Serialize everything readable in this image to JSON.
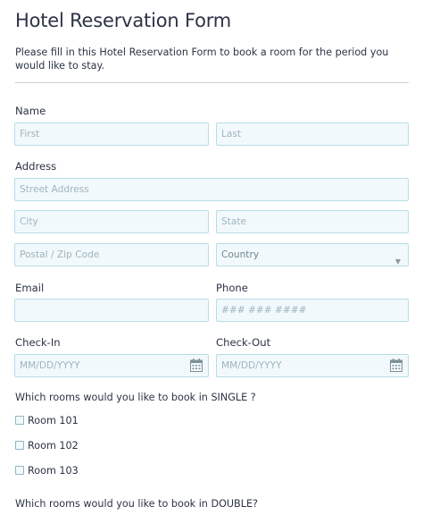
{
  "form": {
    "title": "Hotel Reservation Form",
    "description": "Please fill in this Hotel Reservation Form to book a room for the period you would like to stay."
  },
  "name": {
    "label": "Name",
    "first_placeholder": "First",
    "last_placeholder": "Last"
  },
  "address": {
    "label": "Address",
    "street_placeholder": "Street Address",
    "city_placeholder": "City",
    "state_placeholder": "State",
    "zip_placeholder": "Postal / Zip Code",
    "country_value": "Country"
  },
  "email": {
    "label": "Email",
    "placeholder": ""
  },
  "phone": {
    "label": "Phone",
    "placeholder": "### ### ####"
  },
  "checkin": {
    "label": "Check-In",
    "placeholder": "MM/DD/YYYY"
  },
  "checkout": {
    "label": "Check-Out",
    "placeholder": "MM/DD/YYYY"
  },
  "single": {
    "question": "Which rooms would you like to book in SINGLE ?",
    "rooms": [
      "Room 101",
      "Room 102",
      "Room 103"
    ]
  },
  "double": {
    "question": "Which rooms would you like to book in DOUBLE?"
  },
  "icons": {
    "calendar": "calendar-icon",
    "dropdown": "chevron-down-icon"
  },
  "colors": {
    "input_border": "#b9dce6",
    "input_bg": "#f2f9fc",
    "text": "#2c3345"
  }
}
